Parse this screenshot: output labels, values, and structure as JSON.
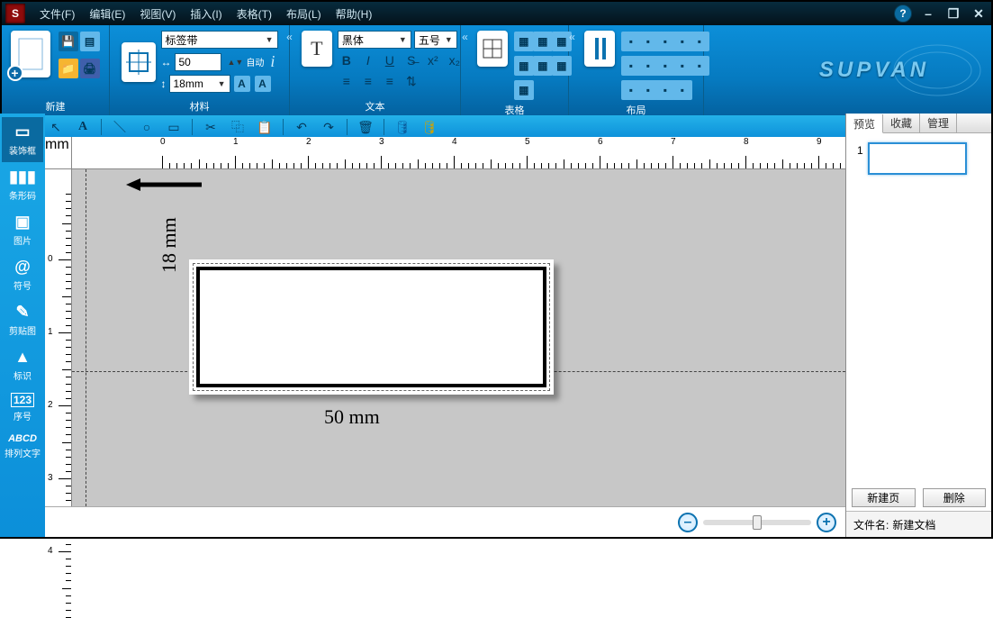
{
  "menu": {
    "file": "文件(F)",
    "edit": "编辑(E)",
    "view": "视图(V)",
    "insert": "插入(I)",
    "table": "表格(T)",
    "layout": "布局(L)",
    "help": "帮助(H)"
  },
  "window": {
    "help": "?",
    "min": "–",
    "restore": "❐",
    "close": "✕"
  },
  "ribbon": {
    "new": "新建",
    "material": "材料",
    "text": "文本",
    "table": "表格",
    "layout": "布局",
    "material_type": "标签带",
    "width_val": "50",
    "height_val": "18mm",
    "auto": "自动",
    "font_family": "黑体",
    "font_size": "五号",
    "brand": "SUPVAN"
  },
  "sidebar": {
    "items": [
      {
        "label": "装饰框"
      },
      {
        "label": "条形码"
      },
      {
        "label": "图片"
      },
      {
        "label": "符号"
      },
      {
        "label": "剪贴图"
      },
      {
        "label": "标识"
      },
      {
        "label": "序号"
      },
      {
        "label": "排列文字"
      }
    ]
  },
  "ruler": {
    "unit": "mm",
    "zero": "0",
    "marks": [
      "0",
      "1",
      "2",
      "3",
      "4",
      "5",
      "6",
      "7",
      "8",
      "9"
    ]
  },
  "canvas": {
    "height_label": "18 mm",
    "width_label": "50 mm"
  },
  "zoom": {
    "pct": 50
  },
  "right": {
    "tabs": {
      "preview": "预览",
      "favorites": "收藏",
      "manage": "管理"
    },
    "page_number": "1",
    "btn_new": "新建页",
    "btn_del": "删除",
    "file_label": "文件名:",
    "file_name": "新建文档"
  }
}
